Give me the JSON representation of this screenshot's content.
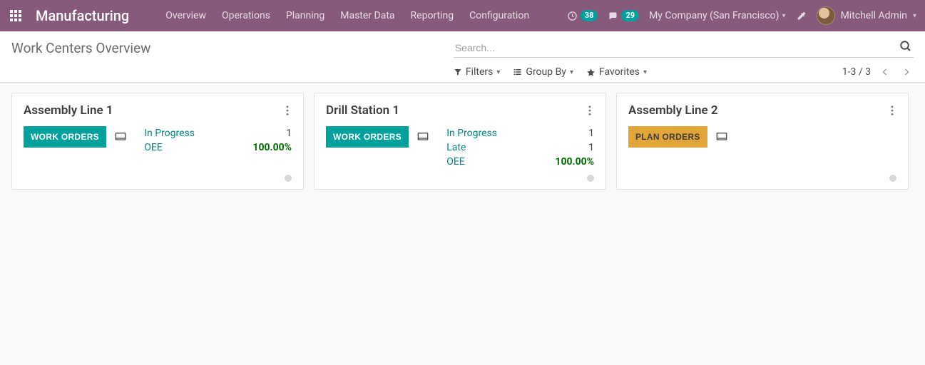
{
  "navbar": {
    "brand": "Manufacturing",
    "menu": [
      "Overview",
      "Operations",
      "Planning",
      "Master Data",
      "Reporting",
      "Configuration"
    ],
    "activity_count": "38",
    "message_count": "29",
    "company": "My Company (San Francisco)",
    "user": "Mitchell Admin"
  },
  "control_panel": {
    "breadcrumb": "Work Centers Overview",
    "search_placeholder": "Search...",
    "filters_label": "Filters",
    "groupby_label": "Group By",
    "favorites_label": "Favorites",
    "pager": "1-3 / 3"
  },
  "cards": [
    {
      "title": "Assembly Line 1",
      "button_label": "WORK ORDERS",
      "button_style": "teal",
      "metrics": [
        {
          "label": "In Progress",
          "value": "1",
          "oee": false
        },
        {
          "label": "OEE",
          "value": "100.00%",
          "oee": true
        }
      ]
    },
    {
      "title": "Drill Station 1",
      "button_label": "WORK ORDERS",
      "button_style": "teal",
      "metrics": [
        {
          "label": "In Progress",
          "value": "1",
          "oee": false
        },
        {
          "label": "Late",
          "value": "1",
          "oee": false
        },
        {
          "label": "OEE",
          "value": "100.00%",
          "oee": true
        }
      ]
    },
    {
      "title": "Assembly Line 2",
      "button_label": "PLAN ORDERS",
      "button_style": "amber",
      "metrics": []
    }
  ]
}
